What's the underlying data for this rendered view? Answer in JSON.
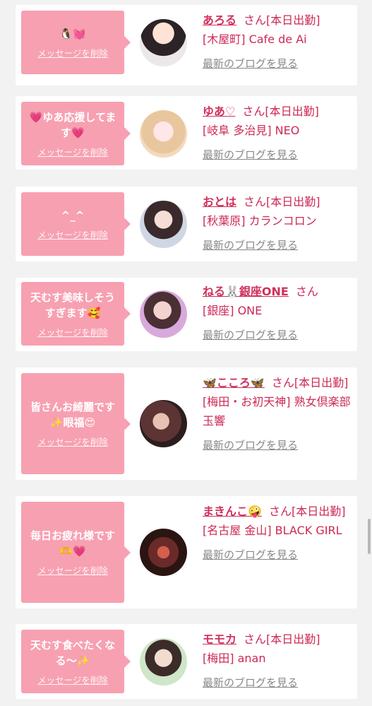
{
  "delete_label": "メッセージを削除",
  "blog_label": "最新のブログを見る",
  "honorific": "さん",
  "colors": {
    "accent_pink": "#f7a0b1",
    "name_pink": "#d0305c",
    "background": "#f2f2f2"
  },
  "items": [
    {
      "message": "🐧💓",
      "name": "あろる",
      "status": "[本日出勤]",
      "shop": "[木屋町] Cafe de Ai"
    },
    {
      "message": "💗ゆあ応援してます💗",
      "name": "ゆあ♡",
      "status": "[本日出勤]",
      "shop": "[岐阜 多治見] NEO"
    },
    {
      "message": "^_^",
      "name": "おとは",
      "status": "[本日出勤]",
      "shop": "[秋葉原] カランコロン"
    },
    {
      "message": "天むす美味しそうすぎます🥰",
      "name": "ねる🐰銀座ONE",
      "status": "",
      "shop": "[銀座] ONE"
    },
    {
      "message": "皆さんお綺麗です✨眼福😍",
      "name": "🦋こころ🦋",
      "status": "[本日出勤]",
      "shop": "[梅田・お初天神] 熟女倶楽部 玉響"
    },
    {
      "message": "毎日お疲れ様です🫶💗",
      "name": "まきんこ🤪",
      "status": "[本日出勤]",
      "shop": "[名古屋 金山] BLACK GIRL"
    },
    {
      "message": "天むす食べたくなる〜✨",
      "name": "モモカ",
      "status": "[本日出勤]",
      "shop": "[梅田] anan"
    }
  ]
}
